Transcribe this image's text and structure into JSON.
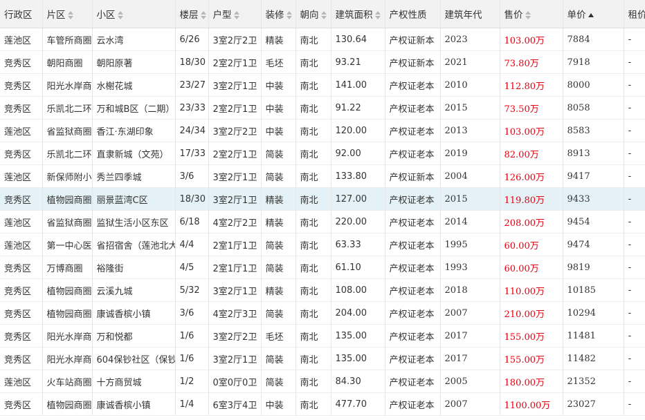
{
  "columns": [
    {
      "label": "行政区",
      "sort": "none"
    },
    {
      "label": "片区",
      "sort": "both"
    },
    {
      "label": "小区",
      "sort": "both"
    },
    {
      "label": "楼层",
      "sort": "both"
    },
    {
      "label": "户型",
      "sort": "both"
    },
    {
      "label": "装修",
      "sort": "both"
    },
    {
      "label": "朝向",
      "sort": "both"
    },
    {
      "label": "建筑面积",
      "sort": "both"
    },
    {
      "label": "产权性质",
      "sort": "none"
    },
    {
      "label": "建筑年代",
      "sort": "none"
    },
    {
      "label": "售价",
      "sort": "both"
    },
    {
      "label": "单价",
      "sort": "asc"
    },
    {
      "label": "租价",
      "sort": "none"
    }
  ],
  "selected_row": 7,
  "colors": {
    "price": "#e3000f",
    "selected": "#e4f1f6",
    "header": "#f2f2f2"
  },
  "rows": [
    [
      "莲池区",
      "车管所商圈",
      "云水湾",
      "6/26",
      "3室2厅2卫",
      "精装",
      "南北",
      "130.64",
      "产权证新本",
      "2023",
      "103.00万",
      "7884",
      "-"
    ],
    [
      "竞秀区",
      "朝阳商圈",
      "朝阳原著",
      "18/30",
      "2室2厅1卫",
      "毛坯",
      "南北",
      "93.21",
      "产权证新本",
      "2021",
      "73.80万",
      "7918",
      "-"
    ],
    [
      "竞秀区",
      "阳光水岸商圈",
      "水榭花城",
      "23/27",
      "3室2厅1卫",
      "中装",
      "南北",
      "141.00",
      "产权证老本",
      "2010",
      "112.80万",
      "8000",
      "-"
    ],
    [
      "竞秀区",
      "乐凯北二环",
      "万和城B区（二期）",
      "23/33",
      "2室2厅1卫",
      "中装",
      "南北",
      "91.22",
      "产权证老本",
      "2015",
      "73.50万",
      "8058",
      "-"
    ],
    [
      "莲池区",
      "省监狱商圈",
      "香江·东湖印象",
      "24/34",
      "3室2厅2卫",
      "中装",
      "南北",
      "120.00",
      "产权证老本",
      "2013",
      "103.00万",
      "8583",
      "-"
    ],
    [
      "竞秀区",
      "乐凯北二环",
      "直隶新城（文苑）",
      "17/33",
      "2室2厅1卫",
      "简装",
      "南北",
      "92.00",
      "产权证老本",
      "2019",
      "82.00万",
      "8913",
      "-"
    ],
    [
      "莲池区",
      "新保师附小",
      "秀兰四季城",
      "3/6",
      "3室2厅1卫",
      "简装",
      "南北",
      "133.80",
      "产权证新本",
      "2004",
      "126.00万",
      "9417",
      "-"
    ],
    [
      "竞秀区",
      "植物园商圈",
      "丽景蓝湾C区",
      "18/30",
      "3室2厅1卫",
      "精装",
      "南北",
      "127.00",
      "产权证老本",
      "2015",
      "119.80万",
      "9433",
      "-"
    ],
    [
      "莲池区",
      "省监狱商圈",
      "监狱生活小区东区",
      "6/18",
      "4室2厅2卫",
      "精装",
      "南北",
      "220.00",
      "产权证老本",
      "2014",
      "208.00万",
      "9454",
      "-"
    ],
    [
      "莲池区",
      "第一中心医",
      "省招宿舍（莲池北大",
      "4/4",
      "2室1厅1卫",
      "简装",
      "南北",
      "63.33",
      "产权证老本",
      "1995",
      "60.00万",
      "9474",
      "-"
    ],
    [
      "竞秀区",
      "万博商圈",
      "裕隆街",
      "4/5",
      "2室1厅1卫",
      "简装",
      "南北",
      "61.10",
      "产权证老本",
      "1993",
      "60.00万",
      "9819",
      "-"
    ],
    [
      "竞秀区",
      "植物园商圈",
      "云溪九城",
      "5/32",
      "3室2厅1卫",
      "精装",
      "南北",
      "108.00",
      "产权证老本",
      "2018",
      "110.00万",
      "10185",
      "-"
    ],
    [
      "竞秀区",
      "植物园商圈",
      "康诚香槟小镇",
      "3/6",
      "4室2厅3卫",
      "简装",
      "南北",
      "204.00",
      "产权证老本",
      "2007",
      "210.00万",
      "10294",
      "-"
    ],
    [
      "竞秀区",
      "阳光水岸商",
      "万和悦都",
      "1/6",
      "3室2厅2卫",
      "毛坯",
      "南北",
      "135.00",
      "产权证老本",
      "2017",
      "155.00万",
      "11481",
      "-"
    ],
    [
      "竞秀区",
      "阳光水岸商",
      "604保钞社区（保钞",
      "1/6",
      "3室2厅1卫",
      "简装",
      "南北",
      "135.00",
      "产权证老本",
      "2017",
      "155.00万",
      "11482",
      "-"
    ],
    [
      "莲池区",
      "火车站商圈",
      "十方商贸城",
      "1/2",
      "0室0厅0卫",
      "简装",
      "南北",
      "84.30",
      "产权证老本",
      "2005",
      "180.00万",
      "21352",
      "-"
    ],
    [
      "竞秀区",
      "植物园商圈",
      "康诚香槟小镇",
      "1/4",
      "6室3厅4卫",
      "中装",
      "南北",
      "477.70",
      "产权证老本",
      "2007",
      "1100.00万",
      "23027",
      "-"
    ]
  ]
}
